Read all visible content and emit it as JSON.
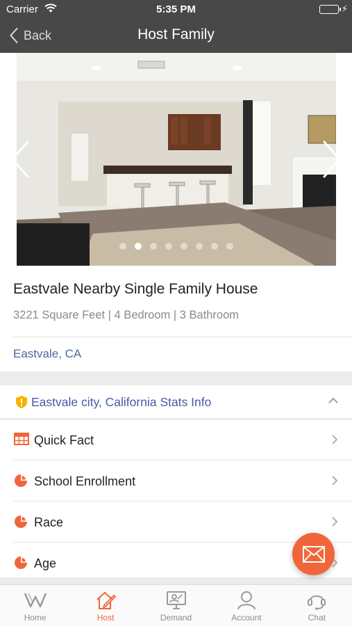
{
  "status_bar": {
    "carrier": "Carrier",
    "time": "5:35 PM",
    "battery_level": 1.0
  },
  "nav": {
    "back_label": "Back",
    "title": "Host Family"
  },
  "gallery": {
    "image_subject": "interior-kitchen-living-room-photo",
    "dot_count": 8,
    "active_dot": 1
  },
  "listing": {
    "title": "Eastvale Nearby Single Family House",
    "specs": "3221 Square Feet | 4 Bedroom | 3 Bathroom",
    "location": "Eastvale, CA"
  },
  "stats": {
    "header": "Eastvale city, California Stats Info",
    "rows": [
      {
        "label": "Quick Fact",
        "icon": "table-icon"
      },
      {
        "label": "School Enrollment",
        "icon": "pie-chart-icon"
      },
      {
        "label": "Race",
        "icon": "pie-chart-icon"
      },
      {
        "label": "Age",
        "icon": "pie-chart-icon"
      }
    ]
  },
  "tabs": [
    {
      "label": "Home",
      "icon": "home-logo-icon",
      "active": false
    },
    {
      "label": "Host",
      "icon": "host-icon",
      "active": true
    },
    {
      "label": "Demand",
      "icon": "demand-icon",
      "active": false
    },
    {
      "label": "Account",
      "icon": "account-icon",
      "active": false
    },
    {
      "label": "Chat",
      "icon": "chat-icon",
      "active": false
    }
  ],
  "colors": {
    "accent": "#f0663a",
    "nav_bg": "#484848",
    "link": "#4a6a9a",
    "stats_header": "#4a5aa3",
    "shield": "#f5b400",
    "tab_inactive": "#8c8c8c"
  }
}
